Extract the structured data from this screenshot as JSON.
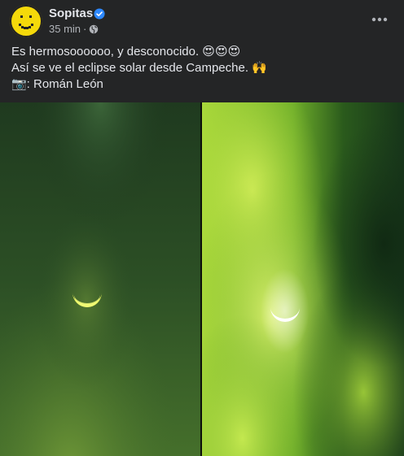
{
  "post": {
    "page_name": "Sopitas",
    "timestamp": "35 min",
    "separator": "·",
    "audience_icon": "globe-icon",
    "verified_icon": "verified-badge-icon",
    "more_icon": "more-options-icon",
    "caption": {
      "line1": "Es hermosoooooo, y desconocido. 😍😍😍",
      "line2": "Así se ve el eclipse solar desde Campeche. 🙌",
      "line3": "📷: Román León"
    },
    "photos": [
      {
        "description_icon": "eclipse-photo-green-dark"
      },
      {
        "description_icon": "eclipse-photo-green-clouds"
      }
    ]
  },
  "colors": {
    "background": "#242526",
    "text_primary": "#e4e6eb",
    "text_secondary": "#b0b3b8",
    "verified": "#2d88ff",
    "avatar": "#f5d90a"
  }
}
